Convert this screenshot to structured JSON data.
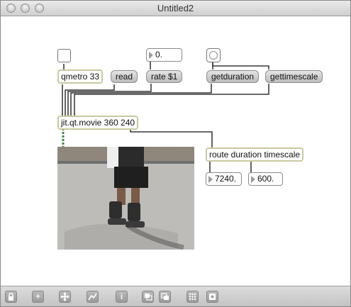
{
  "window": {
    "title": "Untitled2"
  },
  "objects": {
    "qmetro": "qmetro 33",
    "read": "read",
    "rate": "rate $1",
    "getduration": "getduration",
    "gettimescale": "gettimescale",
    "jit_movie": "jit.qt.movie 360 240",
    "route": "route duration timescale"
  },
  "numbers": {
    "rate_value": "0.",
    "duration_value": "7240.",
    "timescale_value": "600."
  },
  "toolbar": {
    "icons": [
      "lock-icon",
      "add-icon",
      "move-icon",
      "inspector-icon",
      "info-icon",
      "window-icon",
      "window-alt-icon",
      "grid-icon",
      "snap-icon"
    ]
  }
}
